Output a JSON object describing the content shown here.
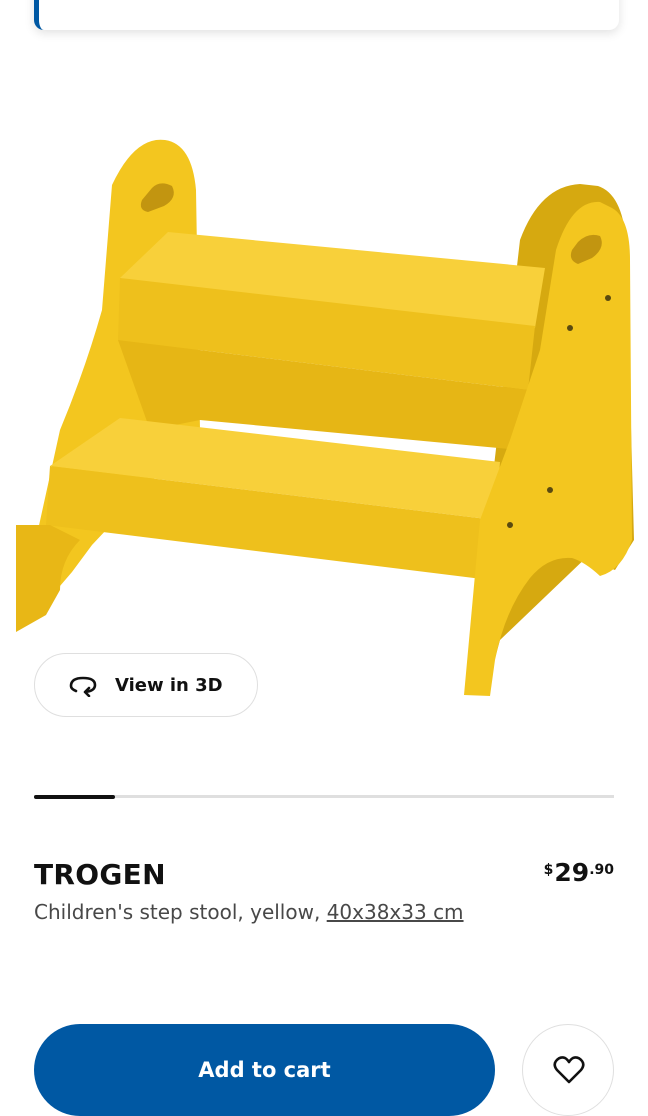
{
  "product": {
    "name": "TROGEN",
    "description": "Children's step stool, yellow, ",
    "dimensions": "40x38x33 cm",
    "price": {
      "currency": "$",
      "integer": "29",
      "decimal": ".90"
    },
    "image": "yellow-step-stool",
    "color": "#f2c520"
  },
  "gallery": {
    "view3d_label": "View in 3D",
    "view3d_icon": "rotate-3d-icon",
    "progress": 0.14
  },
  "actions": {
    "add_to_cart_label": "Add to cart",
    "wishlist_icon": "heart-icon"
  },
  "colors": {
    "primary": "#0058a3",
    "text": "#111111",
    "secondary_text": "#484848",
    "border": "#dfdfdf"
  }
}
